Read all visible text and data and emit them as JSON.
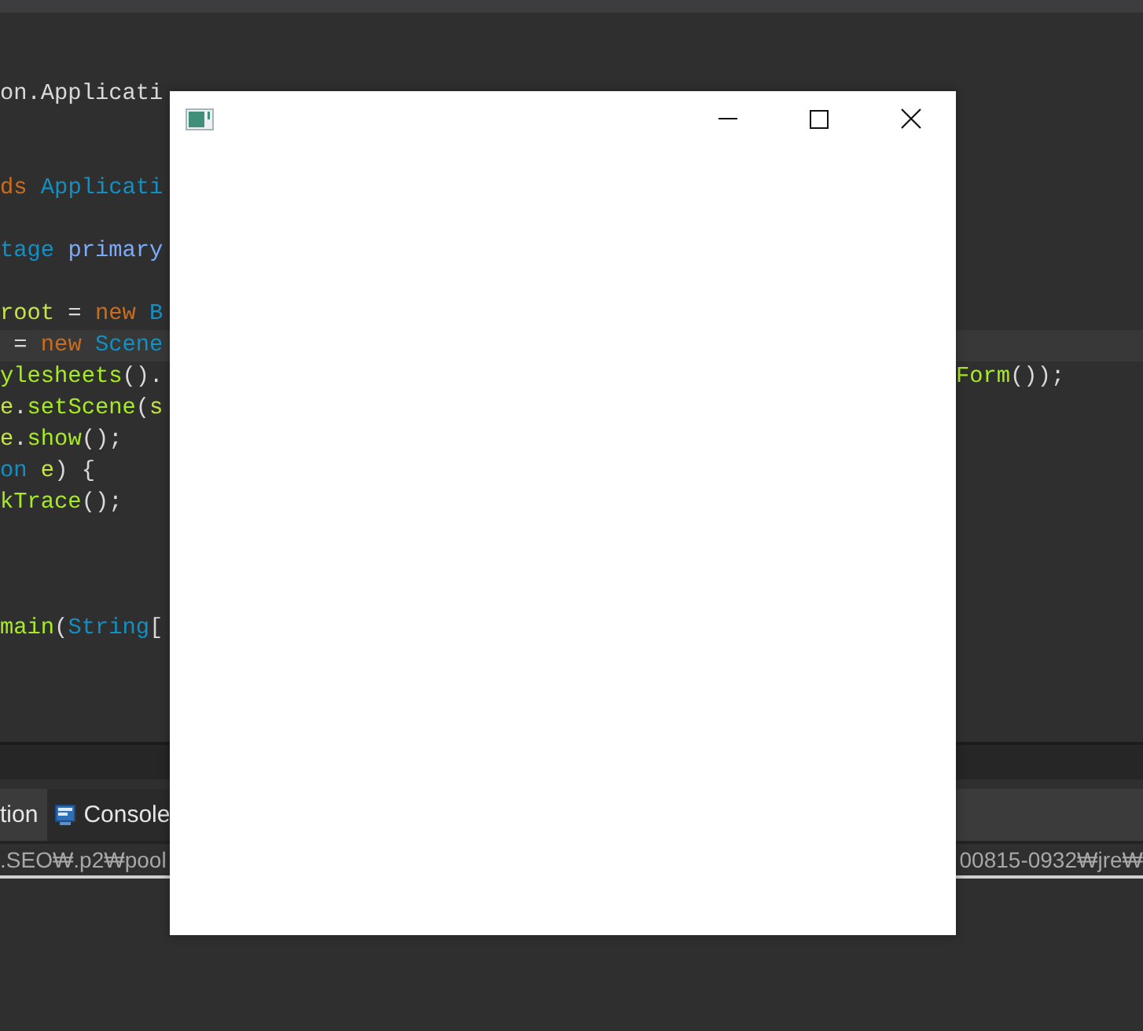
{
  "editor": {
    "lines": [
      {
        "tokens": [
          {
            "kind": "plain",
            "text": "on.Applicati"
          }
        ]
      },
      {
        "tokens": [
          {
            "kind": "keyword",
            "text": "ds "
          },
          {
            "kind": "type",
            "text": "Applicati"
          }
        ]
      },
      {
        "tokens": [
          {
            "kind": "type",
            "text": "tage "
          },
          {
            "kind": "param",
            "text": "primary"
          }
        ]
      },
      {
        "tokens": [
          {
            "kind": "variable",
            "text": "root"
          },
          {
            "kind": "plain",
            "text": " = "
          },
          {
            "kind": "keyword",
            "text": "new "
          },
          {
            "kind": "type",
            "text": "B"
          }
        ]
      },
      {
        "current": true,
        "tokens": [
          {
            "kind": "plain",
            "text": " = "
          },
          {
            "kind": "keyword",
            "text": "new "
          },
          {
            "kind": "type",
            "text": "Scene"
          }
        ]
      },
      {
        "tokens": [
          {
            "kind": "method",
            "text": "ylesheets"
          },
          {
            "kind": "plain",
            "text": "()."
          }
        ],
        "tail": [
          {
            "kind": "method",
            "text": "Form"
          },
          {
            "kind": "plain",
            "text": "());"
          }
        ]
      },
      {
        "tokens": [
          {
            "kind": "variable",
            "text": "e"
          },
          {
            "kind": "plain",
            "text": "."
          },
          {
            "kind": "method",
            "text": "setScene"
          },
          {
            "kind": "plain",
            "text": "("
          },
          {
            "kind": "variable",
            "text": "s"
          }
        ]
      },
      {
        "tokens": [
          {
            "kind": "variable",
            "text": "e"
          },
          {
            "kind": "plain",
            "text": "."
          },
          {
            "kind": "method",
            "text": "show"
          },
          {
            "kind": "plain",
            "text": "();"
          }
        ]
      },
      {
        "tokens": [
          {
            "kind": "type",
            "text": "on "
          },
          {
            "kind": "variable",
            "text": "e"
          },
          {
            "kind": "plain",
            "text": ") {"
          }
        ]
      },
      {
        "tokens": [
          {
            "kind": "method",
            "text": "kTrace"
          },
          {
            "kind": "plain",
            "text": "();"
          }
        ]
      },
      {
        "tokens": [
          {
            "kind": "method",
            "text": "main"
          },
          {
            "kind": "plain",
            "text": "("
          },
          {
            "kind": "type",
            "text": "String"
          },
          {
            "kind": "plain",
            "text": "["
          }
        ]
      }
    ]
  },
  "bottom_panel": {
    "tabs": [
      {
        "label": "tion",
        "selected": false
      },
      {
        "label": "Console",
        "selected": true
      }
    ],
    "console_line": {
      "left": ".SEO₩.p2₩pool",
      "right": "00815-0932₩jre₩"
    }
  }
}
